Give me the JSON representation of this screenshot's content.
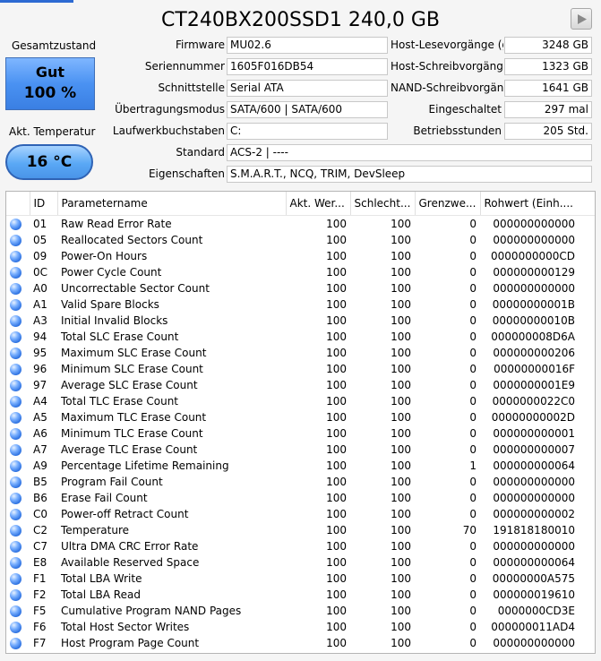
{
  "header": {
    "title": "CT240BX200SSD1 240,0 GB"
  },
  "status": {
    "health_label": "Gesamtzustand",
    "health_value": "Gut",
    "health_percent": "100 %",
    "temp_label": "Akt. Temperatur",
    "temp_value": "16 °C",
    "health_color": "#4a92f2"
  },
  "info_left": [
    {
      "label": "Firmware",
      "value": "MU02.6"
    },
    {
      "label": "Seriennummer",
      "value": "1605F016DB54"
    },
    {
      "label": "Schnittstelle",
      "value": "Serial ATA"
    },
    {
      "label": "Übertragungsmodus",
      "value": "SATA/600 | SATA/600"
    },
    {
      "label": "Laufwerkbuchstaben",
      "value": "C:"
    }
  ],
  "info_right": [
    {
      "label": "Host-Lesevorgänge (ge",
      "value": "3248 GB"
    },
    {
      "label": "Host-Schreibvorgänge (",
      "value": "1323 GB"
    },
    {
      "label": "NAND-Schreibvorgänge",
      "value": "1641 GB"
    },
    {
      "label": "Eingeschaltet",
      "value": "297 mal"
    },
    {
      "label": "Betriebsstunden",
      "value": "205 Std."
    }
  ],
  "info_full": [
    {
      "label": "Standard",
      "value": "ACS-2 | ----"
    },
    {
      "label": "Eigenschaften",
      "value": "S.M.A.R.T., NCQ, TRIM, DevSleep"
    }
  ],
  "table": {
    "headers": [
      "",
      "ID",
      "Parametername",
      "Akt. Wer...",
      "Schlecht...",
      "Grenzwe...",
      "Rohwert (Einh...."
    ],
    "rows": [
      [
        "01",
        "Raw Read Error Rate",
        "100",
        "100",
        "0",
        "000000000000"
      ],
      [
        "05",
        "Reallocated Sectors Count",
        "100",
        "100",
        "0",
        "000000000000"
      ],
      [
        "09",
        "Power-On Hours",
        "100",
        "100",
        "0",
        "0000000000CD"
      ],
      [
        "0C",
        "Power Cycle Count",
        "100",
        "100",
        "0",
        "000000000129"
      ],
      [
        "A0",
        "Uncorrectable Sector Count",
        "100",
        "100",
        "0",
        "000000000000"
      ],
      [
        "A1",
        "Valid Spare Blocks",
        "100",
        "100",
        "0",
        "00000000001B"
      ],
      [
        "A3",
        "Initial Invalid Blocks",
        "100",
        "100",
        "0",
        "00000000010B"
      ],
      [
        "94",
        "Total SLC Erase Count",
        "100",
        "100",
        "0",
        "000000008D6A"
      ],
      [
        "95",
        "Maximum SLC Erase Count",
        "100",
        "100",
        "0",
        "000000000206"
      ],
      [
        "96",
        "Minimum SLC Erase Count",
        "100",
        "100",
        "0",
        "00000000016F"
      ],
      [
        "97",
        "Average SLC Erase Count",
        "100",
        "100",
        "0",
        "0000000001E9"
      ],
      [
        "A4",
        "Total TLC Erase Count",
        "100",
        "100",
        "0",
        "0000000022C0"
      ],
      [
        "A5",
        "Maximum TLC Erase Count",
        "100",
        "100",
        "0",
        "00000000002D"
      ],
      [
        "A6",
        "Minimum TLC Erase Count",
        "100",
        "100",
        "0",
        "000000000001"
      ],
      [
        "A7",
        "Average TLC Erase Count",
        "100",
        "100",
        "0",
        "000000000007"
      ],
      [
        "A9",
        "Percentage Lifetime Remaining",
        "100",
        "100",
        "1",
        "000000000064"
      ],
      [
        "B5",
        "Program Fail Count",
        "100",
        "100",
        "0",
        "000000000000"
      ],
      [
        "B6",
        "Erase Fail Count",
        "100",
        "100",
        "0",
        "000000000000"
      ],
      [
        "C0",
        "Power-off Retract Count",
        "100",
        "100",
        "0",
        "000000000002"
      ],
      [
        "C2",
        "Temperature",
        "100",
        "100",
        "70",
        "191818180010"
      ],
      [
        "C7",
        "Ultra DMA CRC Error Rate",
        "100",
        "100",
        "0",
        "000000000000"
      ],
      [
        "E8",
        "Available Reserved Space",
        "100",
        "100",
        "0",
        "000000000064"
      ],
      [
        "F1",
        "Total LBA Write",
        "100",
        "100",
        "0",
        "00000000A575"
      ],
      [
        "F2",
        "Total LBA Read",
        "100",
        "100",
        "0",
        "000000019610"
      ],
      [
        "F5",
        "Cumulative Program NAND Pages",
        "100",
        "100",
        "0",
        "0000000CD3E"
      ],
      [
        "F6",
        "Total Host Sector Writes",
        "100",
        "100",
        "0",
        "000000011AD4"
      ],
      [
        "F7",
        "Host Program Page Count",
        "100",
        "100",
        "0",
        "000000000000"
      ]
    ]
  },
  "icons": {
    "next_disk": "play-triangle-icon",
    "row_status": "blue-status-dot-icon"
  }
}
